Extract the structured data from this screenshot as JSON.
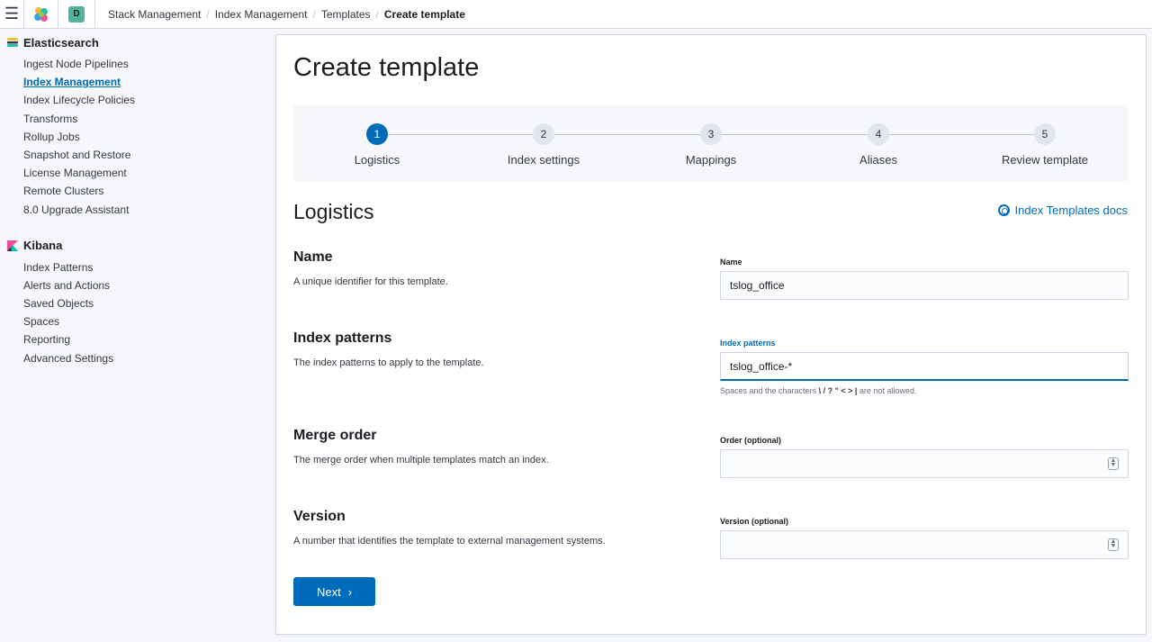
{
  "header": {
    "menu_icon": "hamburger-icon",
    "space_badge": "D",
    "breadcrumbs": [
      "Stack Management",
      "Index Management",
      "Templates",
      "Create template"
    ]
  },
  "sidebar": {
    "groups": [
      {
        "title": "Elasticsearch",
        "items": [
          "Ingest Node Pipelines",
          "Index Management",
          "Index Lifecycle Policies",
          "Transforms",
          "Rollup Jobs",
          "Snapshot and Restore",
          "License Management",
          "Remote Clusters",
          "8.0 Upgrade Assistant"
        ],
        "active_index": 1
      },
      {
        "title": "Kibana",
        "items": [
          "Index Patterns",
          "Alerts and Actions",
          "Saved Objects",
          "Spaces",
          "Reporting",
          "Advanced Settings"
        ]
      }
    ]
  },
  "main": {
    "title": "Create template",
    "steps": [
      {
        "number": "1",
        "title": "Logistics"
      },
      {
        "number": "2",
        "title": "Index settings"
      },
      {
        "number": "3",
        "title": "Mappings"
      },
      {
        "number": "4",
        "title": "Aliases"
      },
      {
        "number": "5",
        "title": "Review template"
      }
    ],
    "active_step": 1,
    "section_title": "Logistics",
    "docs_link": "Index Templates docs",
    "rows": [
      {
        "title": "Name",
        "description": "A unique identifier for this template.",
        "field_label": "Name",
        "value": "tslog_office"
      },
      {
        "title": "Index patterns",
        "description": "The index patterns to apply to the template.",
        "field_label": "Index patterns",
        "value": "tslog_office-*",
        "help_prefix": "Spaces and the characters",
        "help_chars": "\\ / ? \" < > |",
        "help_suffix": "are not allowed."
      },
      {
        "title": "Merge order",
        "description": "The merge order when multiple templates match an index.",
        "field_label": "Order (optional)",
        "value": ""
      },
      {
        "title": "Version",
        "description": "A number that identifies the template to external management systems.",
        "field_label": "Version (optional)",
        "value": ""
      }
    ],
    "next_label": "Next"
  },
  "colors": {
    "accent": "#006bb8",
    "space_badge": "#54b399"
  }
}
